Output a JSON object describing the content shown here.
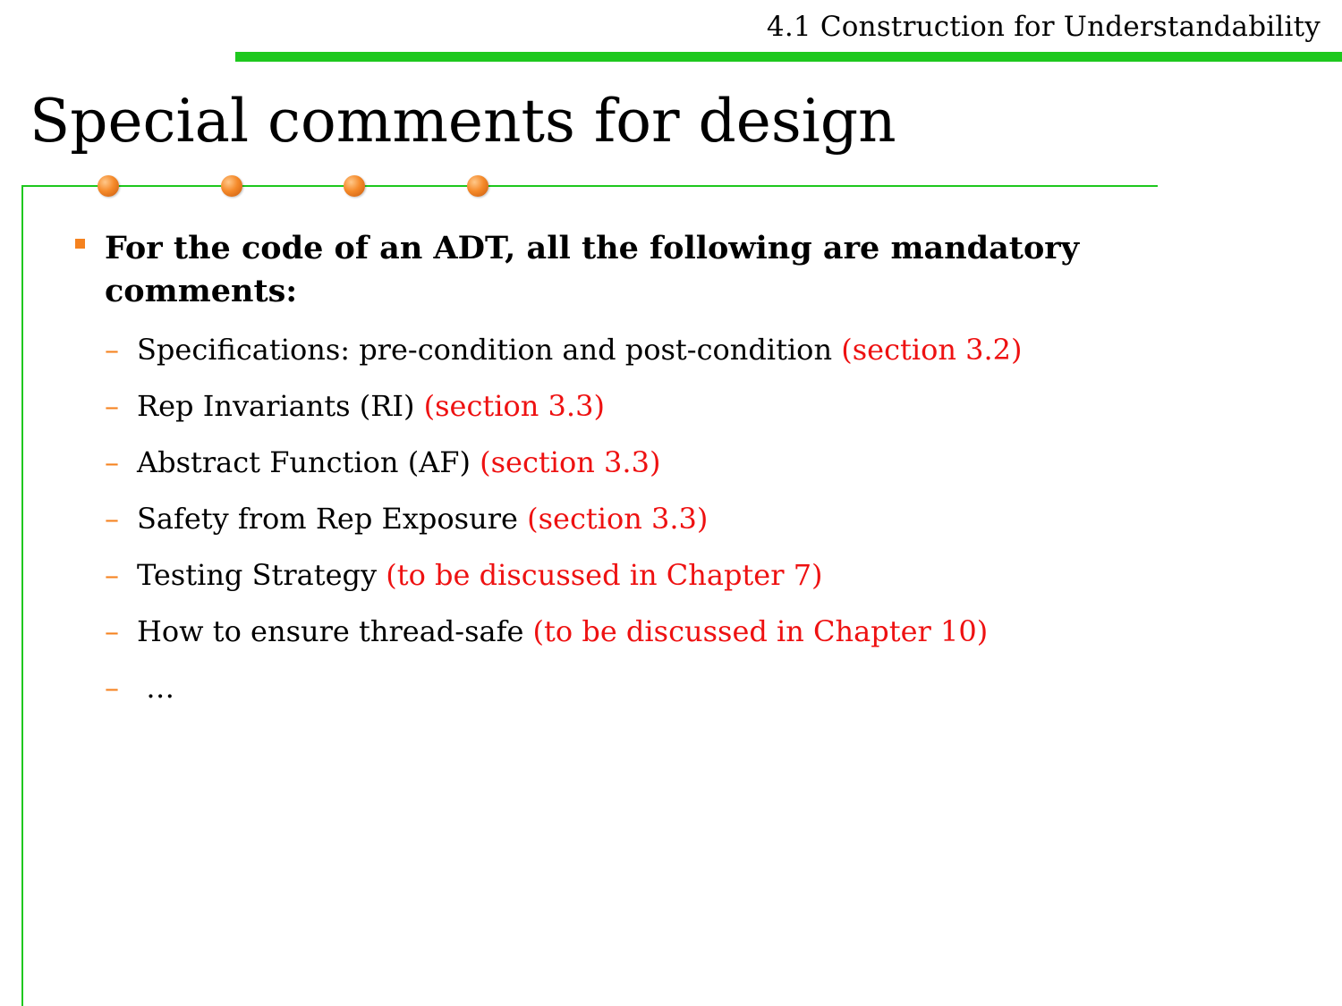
{
  "header": {
    "section": "4.1 Construction for Understandability"
  },
  "title": "Special comments for design",
  "main_point": "For the code of an ADT, all the following are mandatory comments:",
  "items": [
    {
      "text": "Specifications: pre-condition and post-condition ",
      "ref": "(section 3.2)"
    },
    {
      "text": "Rep Invariants (RI) ",
      "ref": "(section 3.3)"
    },
    {
      "text": "Abstract Function (AF) ",
      "ref": "(section 3.3)"
    },
    {
      "text": "Safety from Rep Exposure ",
      "ref": "(section 3.3)"
    },
    {
      "text": "Testing Strategy ",
      "ref": "(to be discussed in Chapter 7)"
    },
    {
      "text": "How to ensure thread-safe ",
      "ref": "(to be discussed in Chapter 10)"
    },
    {
      "text": " …",
      "ref": ""
    }
  ],
  "colors": {
    "accent_green": "#1ec81e",
    "bullet_orange": "#f5821f",
    "reference_red": "#ee1111"
  },
  "icons": {
    "main_bullet": "square-bullet-icon",
    "sub_bullet": "dash-bullet-icon",
    "decoration": "orange-dot-icon"
  }
}
